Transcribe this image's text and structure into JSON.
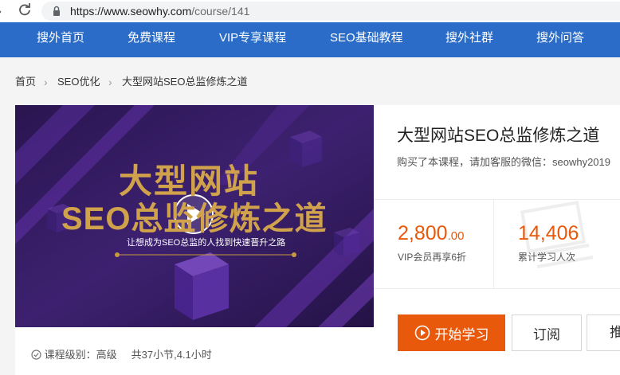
{
  "browser": {
    "url_host": "https://www.seowhy.com",
    "url_path": "/course/141"
  },
  "nav": {
    "items": [
      {
        "label": "搜外首页"
      },
      {
        "label": "免费课程"
      },
      {
        "label": "VIP专享课程"
      },
      {
        "label": "SEO基础教程"
      },
      {
        "label": "搜外社群"
      },
      {
        "label": "搜外问答"
      }
    ]
  },
  "breadcrumb": {
    "home": "首页",
    "category": "SEO优化",
    "current": "大型网站SEO总监修炼之道"
  },
  "banner": {
    "line1": "大型网站",
    "line2": "SEO总监修炼之道",
    "tagline": "让想成为SEO总监的人找到快速晋升之路",
    "colors": {
      "bg": "#3a1f62",
      "text": "#c79a3f"
    }
  },
  "course": {
    "title": "大型网站SEO总监修炼之道",
    "note": "购买了本课程，请加客服的微信：seowhy2019",
    "price_int": "2,800",
    "price_dec": ".00",
    "price_caption": "VIP会员再享6折",
    "learners": "14,406",
    "learners_caption": "累计学习人次",
    "start_label": "开始学习",
    "subscribe_label": "订阅",
    "third_label": "推荐",
    "level_label": "课程级别：高级",
    "sections_label": "共37小节,4.1小时"
  },
  "colors": {
    "nav": "#2a6cc7",
    "accent": "#e8590c"
  }
}
